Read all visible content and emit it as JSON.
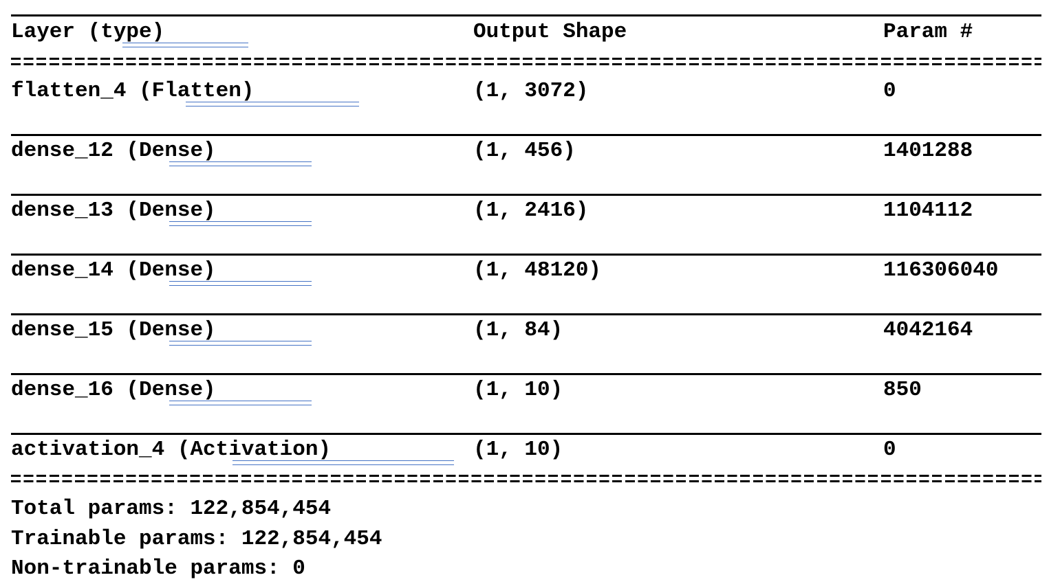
{
  "header": {
    "layer": "Layer (type)",
    "shape": "Output Shape",
    "param": "Param #"
  },
  "rows": [
    {
      "layer": "flatten_4 (Flatten)",
      "shape": "(1, 3072)",
      "param": "0"
    },
    {
      "layer": "dense_12 (Dense)",
      "shape": "(1, 456)",
      "param": "1401288"
    },
    {
      "layer": "dense_13 (Dense)",
      "shape": "(1, 2416)",
      "param": "1104112"
    },
    {
      "layer": "dense_14 (Dense)",
      "shape": "(1, 48120)",
      "param": "116306040"
    },
    {
      "layer": "dense_15 (Dense)",
      "shape": "(1, 84)",
      "param": "4042164"
    },
    {
      "layer": "dense_16 (Dense)",
      "shape": "(1, 10)",
      "param": "850"
    },
    {
      "layer": "activation_4 (Activation)",
      "shape": "(1, 10)",
      "param": "0"
    }
  ],
  "totals": {
    "total": "Total params: 122,854,454",
    "trainable": "Trainable params: 122,854,454",
    "non_trainable": "Non-trainable params: 0"
  },
  "colors": {
    "text": "#000000",
    "spellcheck_underline": "#4472c4"
  }
}
